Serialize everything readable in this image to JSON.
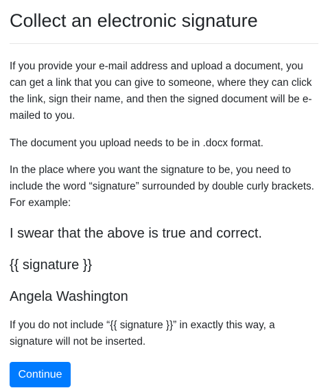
{
  "title": "Collect an electronic signature",
  "paragraphs": [
    "If you provide your e-mail address and upload a document, you can get a link that you can give to someone, where they can click the link, sign their name, and then the signed document will be e-mailed to you.",
    "The document you upload needs to be in .docx format.",
    "In the place where you want the signature to be, you need to include the word “signature” surrounded by double curly brackets. For example:"
  ],
  "example": {
    "line1": "I swear that the above is true and correct.",
    "line2": "{{ signature }}",
    "line3": "Angela Washington"
  },
  "warning": "If you do not include “{{ signature }}” in exactly this way, a signature will not be inserted.",
  "continue_label": "Continue",
  "colors": {
    "primary": "#007bff",
    "text": "#212529"
  }
}
